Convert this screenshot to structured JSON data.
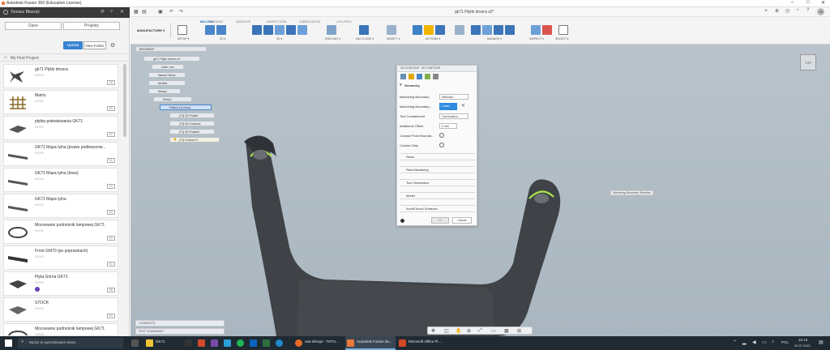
{
  "window": {
    "title": "Autodesk Fusion 360 (Education License)",
    "doc_title": "gk71 Płytki drvera v2*",
    "min": "–",
    "max": "□",
    "close": "✕"
  },
  "left_panel": {
    "user": "Tomasz Błaszyk",
    "tabs": [
      "Dane",
      "Projekty"
    ],
    "upload_label": "Upload",
    "new_folder_label": "New Folder",
    "project_name": "My First Project",
    "files": [
      {
        "name": "gk71 Płytki drivera",
        "ver": "V2/V2",
        "badge": "V2"
      },
      {
        "name": "Matrix",
        "ver": "V1/V1",
        "badge": "V1"
      },
      {
        "name": "płytka potwatowania GK71",
        "ver": "V1/V1",
        "badge": "V1"
      },
      {
        "name": "GK71 Mapa tylna (prawe podtwarzow...",
        "ver": "V1/V1",
        "badge": "V1"
      },
      {
        "name": "GK71 Mapa tylna (lewa)",
        "ver": "V1/V1",
        "badge": "V1"
      },
      {
        "name": "GK71 Mapa tylna",
        "ver": "V1/V1",
        "badge": "V1"
      },
      {
        "name": "Mocowanie podnośnik lampowej GK71",
        "ver": "V1/V1",
        "badge": "V1"
      },
      {
        "name": "Front GM70 (po poprawkach)",
        "ver": "V1/V1",
        "badge": "V1"
      },
      {
        "name": "Płyta Górna GK71",
        "ver": "V1/V1",
        "badge": "V5"
      },
      {
        "name": "STOCK",
        "ver": "V1/V1",
        "badge": "V1"
      },
      {
        "name": "Mocowanie podnośnik lampowej GK71",
        "ver": "V2/V3",
        "badge": "V3"
      }
    ]
  },
  "toolbar": {
    "workspace": "MANUFACTURE ▾",
    "tabs": [
      "MILLING",
      "TURNING",
      "ADDITIVE",
      "INSPECTION",
      "FABRICATION",
      "UTILITIES"
    ],
    "groups": [
      "SETUP ▾",
      "2D ▾",
      "3D ▾",
      "DRILLING ▾",
      "MULTI-AXIS ▾",
      "MODIFY ▾",
      "ACTIONS ▾",
      "MANAGE ▾",
      "INSPECT ▾",
      "SELECT ▾"
    ]
  },
  "browser": {
    "header": "BROWSER",
    "root": "gk71 Płytki drivera v2",
    "items": [
      "Units: mm",
      "Named Views",
      "Models",
      "Setups",
      "Setup1",
      "Pattern1 [Linear]",
      "[T4] 2D Pocket",
      "[T4] 2D Contour1",
      "[T1] 2D Pocket2",
      "[T1] Contour1?"
    ]
  },
  "dialog": {
    "title": "2D CONTOUR : 2D CONTOUR",
    "section_geometry": "Geometry",
    "rows": [
      {
        "label": "Machining Boundary",
        "value": "Selection"
      },
      {
        "label": "Machining Boundary...",
        "value": "1 selec"
      },
      {
        "label": "Tool Containment",
        "value": "Tool inside b..."
      },
      {
        "label": "Additional Offset",
        "value": "0 mm"
      },
      {
        "label": "Contact Point Bounda...",
        "value": ""
      },
      {
        "label": "Contact Only",
        "value": ""
      }
    ],
    "sections": [
      "Stock",
      "Rest Machining",
      "Tool Orientation",
      "Model",
      "Avoid/Touch Surfaces"
    ],
    "ok": "OK",
    "cancel": "Cancel"
  },
  "viewport": {
    "tooltip": "Machining Boundary Selection",
    "bottom_tabs": [
      "COMMENTS",
      "TEXT COMMANDS"
    ],
    "viewcube": "TOP"
  },
  "taskbar": {
    "search_placeholder": "Wpisz tu wyszukiwane słowo",
    "items": [
      "GK71",
      "one.infoopt - TOTU...",
      "Autodesk Fusion 36...",
      "Microsoft Office Pl..."
    ],
    "lang": "POL",
    "time": "16:13",
    "date": "29.07.2021"
  }
}
